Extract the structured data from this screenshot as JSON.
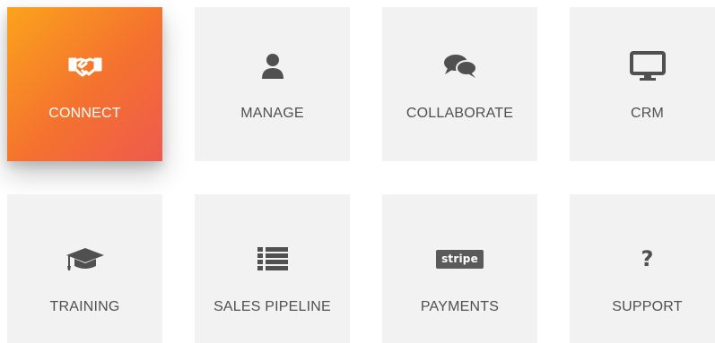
{
  "tiles": [
    {
      "label": "CONNECT",
      "icon": "handshake-icon",
      "active": true
    },
    {
      "label": "MANAGE",
      "icon": "user-icon",
      "active": false
    },
    {
      "label": "COLLABORATE",
      "icon": "chat-bubbles-icon",
      "active": false
    },
    {
      "label": "CRM",
      "icon": "monitor-icon",
      "active": false
    },
    {
      "label": "TRAINING",
      "icon": "graduation-cap-icon",
      "active": false
    },
    {
      "label": "SALES PIPELINE",
      "icon": "list-icon",
      "active": false
    },
    {
      "label": "PAYMENTS",
      "icon": "stripe-icon",
      "active": false,
      "badge_text": "stripe"
    },
    {
      "label": "SUPPORT",
      "icon": "question-mark-icon",
      "active": false,
      "glyph": "?"
    }
  ],
  "colors": {
    "active_gradient_start": "#fba31c",
    "active_gradient_end": "#ee5a4e",
    "tile_background": "#f2f2f2",
    "icon_color": "#505050",
    "label_color": "#505050",
    "active_label_color": "#ffffff"
  }
}
